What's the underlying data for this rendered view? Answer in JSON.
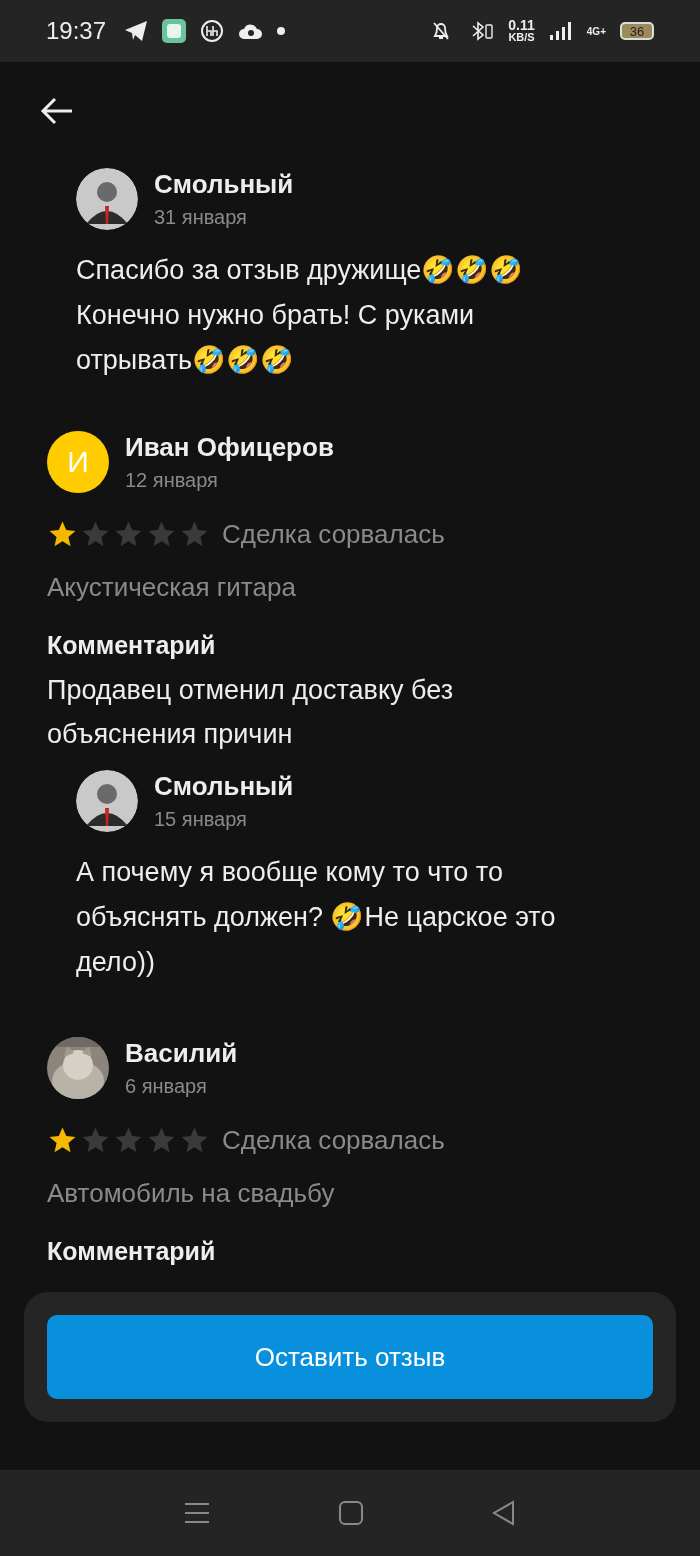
{
  "status_bar": {
    "time": "19:37",
    "net_speed": "0.11",
    "net_unit": "KB/S",
    "network": "4G+",
    "battery": "36"
  },
  "reviews": [
    {
      "kind": "reply",
      "author": "Смольный",
      "avatar": {
        "kind": "person"
      },
      "date": "31 января",
      "text": "Спасибо за отзыв дружище🤣🤣🤣 Конечно нужно брать! С руками отрывать🤣🤣🤣"
    },
    {
      "kind": "review",
      "author": "Иван Офицеров",
      "avatar": {
        "kind": "letter",
        "letter": "И",
        "color": "#ffcc00"
      },
      "date": "12 января",
      "stars": 1,
      "status": "Сделка сорвалась",
      "item": "Акустическая гитара",
      "comment_label": "Комментарий",
      "comment": "Продавец отменил доставку без объяснения причин",
      "replies": [
        {
          "kind": "reply",
          "author": "Смольный",
          "avatar": {
            "kind": "person"
          },
          "date": "15 января",
          "text": "А почему я вообще кому то что то объяснять должен? 🤣Не царское это дело))"
        }
      ]
    },
    {
      "kind": "review",
      "author": "Василий",
      "date": "6 января",
      "stars": 1,
      "status": "Сделка сорвалась",
      "item": "Автомобиль на свадьбу",
      "comment_label": "Комментарий"
    }
  ],
  "action_button": "Оставить отзыв"
}
